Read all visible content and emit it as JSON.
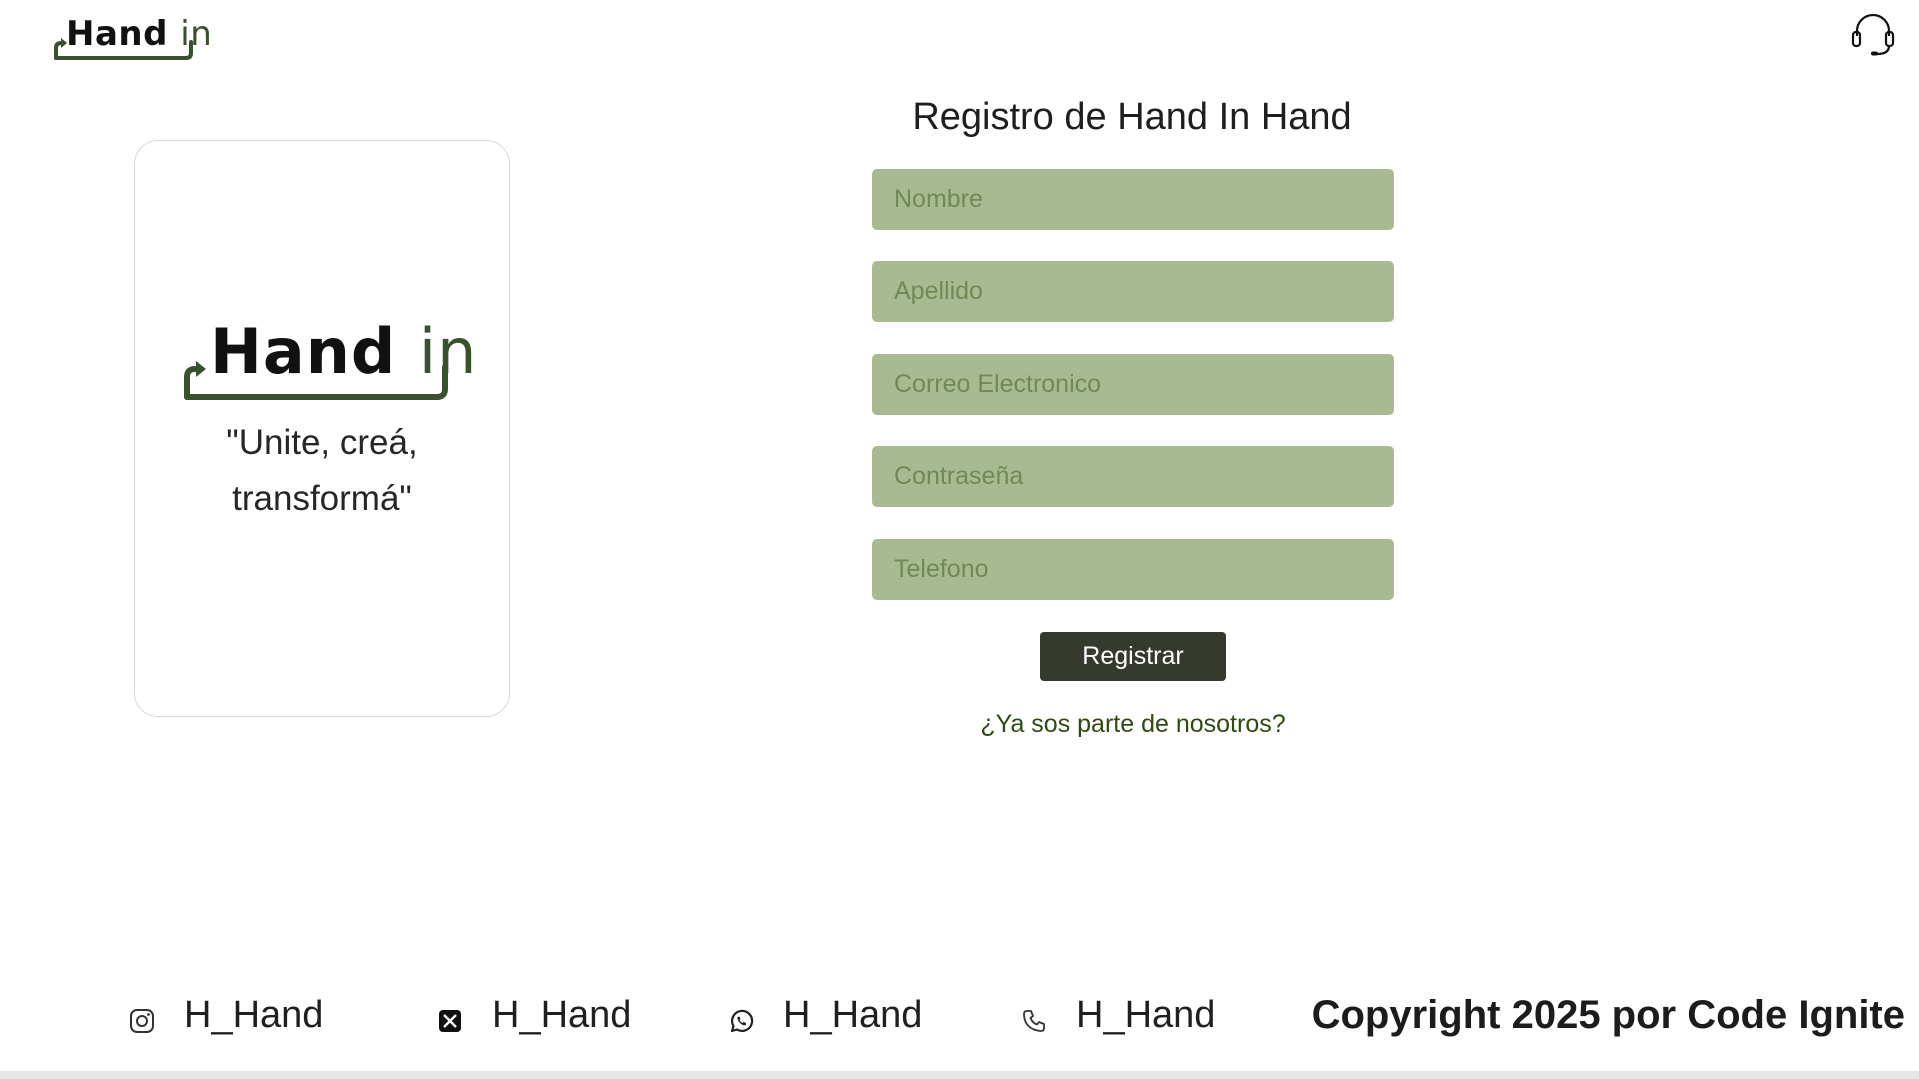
{
  "header": {
    "logo_text_main": "Hand",
    "logo_text_accent": "in",
    "support_icon": "headset-icon"
  },
  "card": {
    "logo_text_main": "Hand",
    "logo_text_accent": "in",
    "tagline_line1": "\"Unite, creá,",
    "tagline_line2": "transformá\""
  },
  "form": {
    "title": "Registro de Hand In Hand",
    "fields": [
      {
        "placeholder": "Nombre",
        "value": ""
      },
      {
        "placeholder": "Apellido",
        "value": ""
      },
      {
        "placeholder": "Correo Electronico",
        "value": ""
      },
      {
        "placeholder": "Contraseña",
        "value": ""
      },
      {
        "placeholder": "Telefono",
        "value": ""
      }
    ],
    "submit_label": "Registrar",
    "login_link": "¿Ya sos parte de nosotros?"
  },
  "footer": {
    "socials": [
      {
        "icon": "instagram-icon",
        "handle": "H_Hand"
      },
      {
        "icon": "x-icon",
        "handle": "H_Hand"
      },
      {
        "icon": "whatsapp-icon",
        "handle": "H_Hand"
      },
      {
        "icon": "phone-icon",
        "handle": "H_Hand"
      }
    ],
    "copyright": "Copyright 2025 por Code Ignite"
  },
  "colors": {
    "field_bg": "#a9ba93",
    "placeholder": "#6f8a55",
    "button_bg": "#363a2e",
    "link": "#2f4a12",
    "logo_accent": "#3a5130"
  }
}
